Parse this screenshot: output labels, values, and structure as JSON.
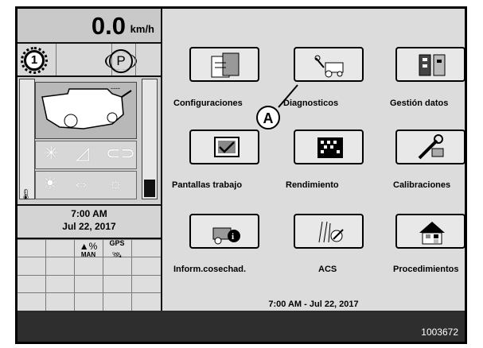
{
  "speed": {
    "value": "0.0",
    "unit": "km/h"
  },
  "status": {
    "gear": "1",
    "park": "P"
  },
  "combine_display": {
    "dashes": "----"
  },
  "clock": {
    "time": "7:00 AM",
    "date": "Jul 22, 2017"
  },
  "grid": {
    "gps_label": "GPS",
    "man_label": "MAN"
  },
  "menu": {
    "items": [
      {
        "label": "Configuraciones",
        "icon": "settings-book-icon"
      },
      {
        "label": "Diagnosticos",
        "icon": "combine-tools-icon"
      },
      {
        "label": "Gestión datos",
        "icon": "data-management-icon"
      },
      {
        "label": "Pantallas trabajo",
        "icon": "work-screen-icon"
      },
      {
        "label": "Rendimiento",
        "icon": "performance-grid-icon"
      },
      {
        "label": "Calibraciones",
        "icon": "calibration-wrench-icon"
      },
      {
        "label": "Inform.cosechad.",
        "icon": "harvest-info-icon"
      },
      {
        "label": "ACS",
        "icon": "acs-icon"
      },
      {
        "label": "Procedimientos",
        "icon": "procedures-house-icon"
      }
    ]
  },
  "footer_time": "7:00 AM - Jul 22, 2017",
  "callout": "A",
  "figure_number": "1003672"
}
